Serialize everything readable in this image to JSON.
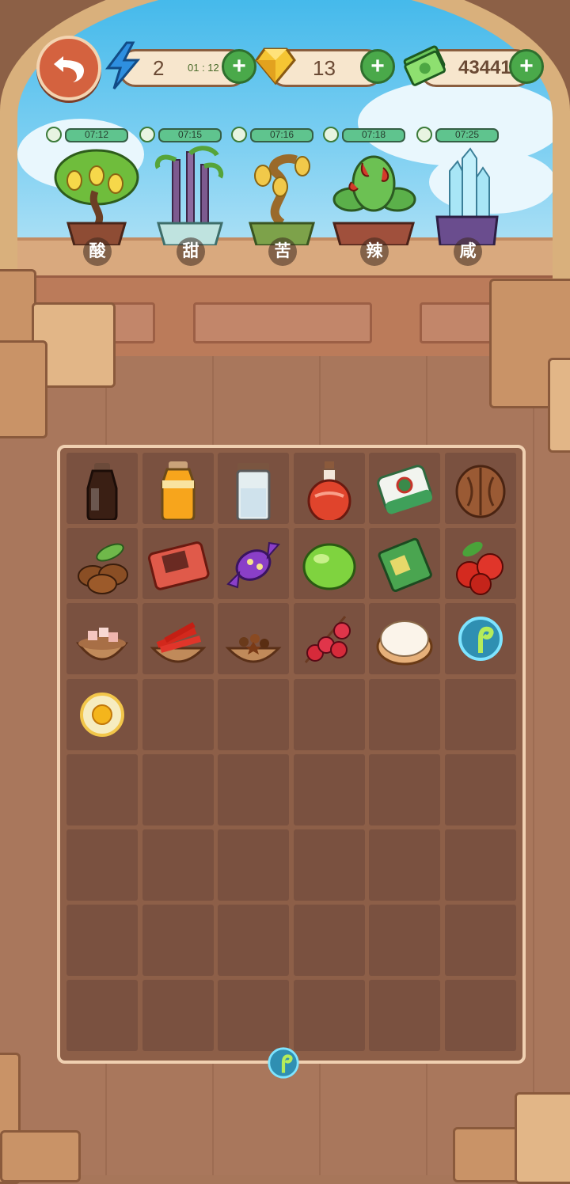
{
  "topbar": {
    "energy": {
      "value": "2",
      "timer": "01 : 12"
    },
    "gems": {
      "value": "13"
    },
    "cash": {
      "value": "43441"
    }
  },
  "plants": [
    {
      "label": "酸",
      "timer": "07:12",
      "icon": "lemon-tree"
    },
    {
      "label": "甜",
      "timer": "07:15",
      "icon": "sugarcane"
    },
    {
      "label": "苦",
      "timer": "07:16",
      "icon": "bitter-gourd-vine"
    },
    {
      "label": "辣",
      "timer": "07:18",
      "icon": "chili-plant"
    },
    {
      "label": "咸",
      "timer": "07:25",
      "icon": "salt-crystal"
    }
  ],
  "board": {
    "rows": 8,
    "cols": 6,
    "items": [
      [
        "soy-sauce-bottle",
        "orange-juice-jar",
        "sugar-jar",
        "red-potion-flask",
        "mahjong-tile",
        "walnut"
      ],
      [
        "coffee-beans",
        "handheld-game",
        "purple-candy",
        "lime",
        "green-notebook",
        "hawthorn-berries"
      ],
      [
        "pink-salt-bowl",
        "chili-bowl",
        "spice-bowl",
        "lychee-branch",
        "cream-puff",
        "green-sprout-bubble"
      ],
      [
        "egg-yolk-bubble",
        "",
        "",
        "",
        "",
        ""
      ],
      [
        "",
        "",
        "",
        "",
        "",
        ""
      ],
      [
        "",
        "",
        "",
        "",
        "",
        ""
      ],
      [
        "",
        "",
        "",
        "",
        "",
        ""
      ],
      [
        "",
        "",
        "",
        "",
        "",
        ""
      ]
    ]
  },
  "bottom_item": "green-sprout-bubble"
}
